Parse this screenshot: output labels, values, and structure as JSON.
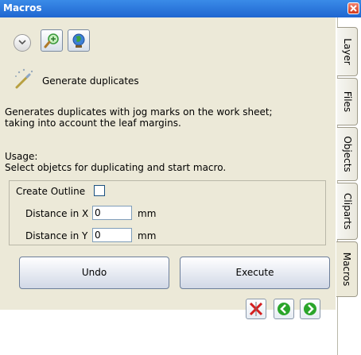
{
  "window": {
    "title": "Macros"
  },
  "macro": {
    "name": "Generate duplicates",
    "description_line1": "Generates duplicates with jog marks on the work sheet;",
    "description_line2": "taking into account the leaf margins.",
    "usage_label": "Usage:",
    "usage_text": "Select objetcs for duplicating and start macro."
  },
  "options": {
    "create_outline_label": "Create Outline",
    "create_outline_checked": false,
    "distance_x_label": "Distance in X",
    "distance_x_value": "0",
    "distance_y_label": "Distance in Y",
    "distance_y_value": "0",
    "unit": "mm"
  },
  "buttons": {
    "undo": "Undo",
    "execute": "Execute"
  },
  "tabs": [
    "Layer",
    "Files",
    "Objects",
    "Cliparts",
    "Macros"
  ],
  "icons": [
    "close-icon",
    "chevron-down-icon",
    "zoom-icon",
    "globe-icon",
    "magic-wand-icon",
    "delete-icon",
    "back-arrow-icon",
    "forward-arrow-icon"
  ],
  "colors": {
    "titlebar": "#2a74dd",
    "panel": "#ece9d8",
    "arrow_green": "#2aa52a",
    "delete_red": "#d51f1f"
  }
}
